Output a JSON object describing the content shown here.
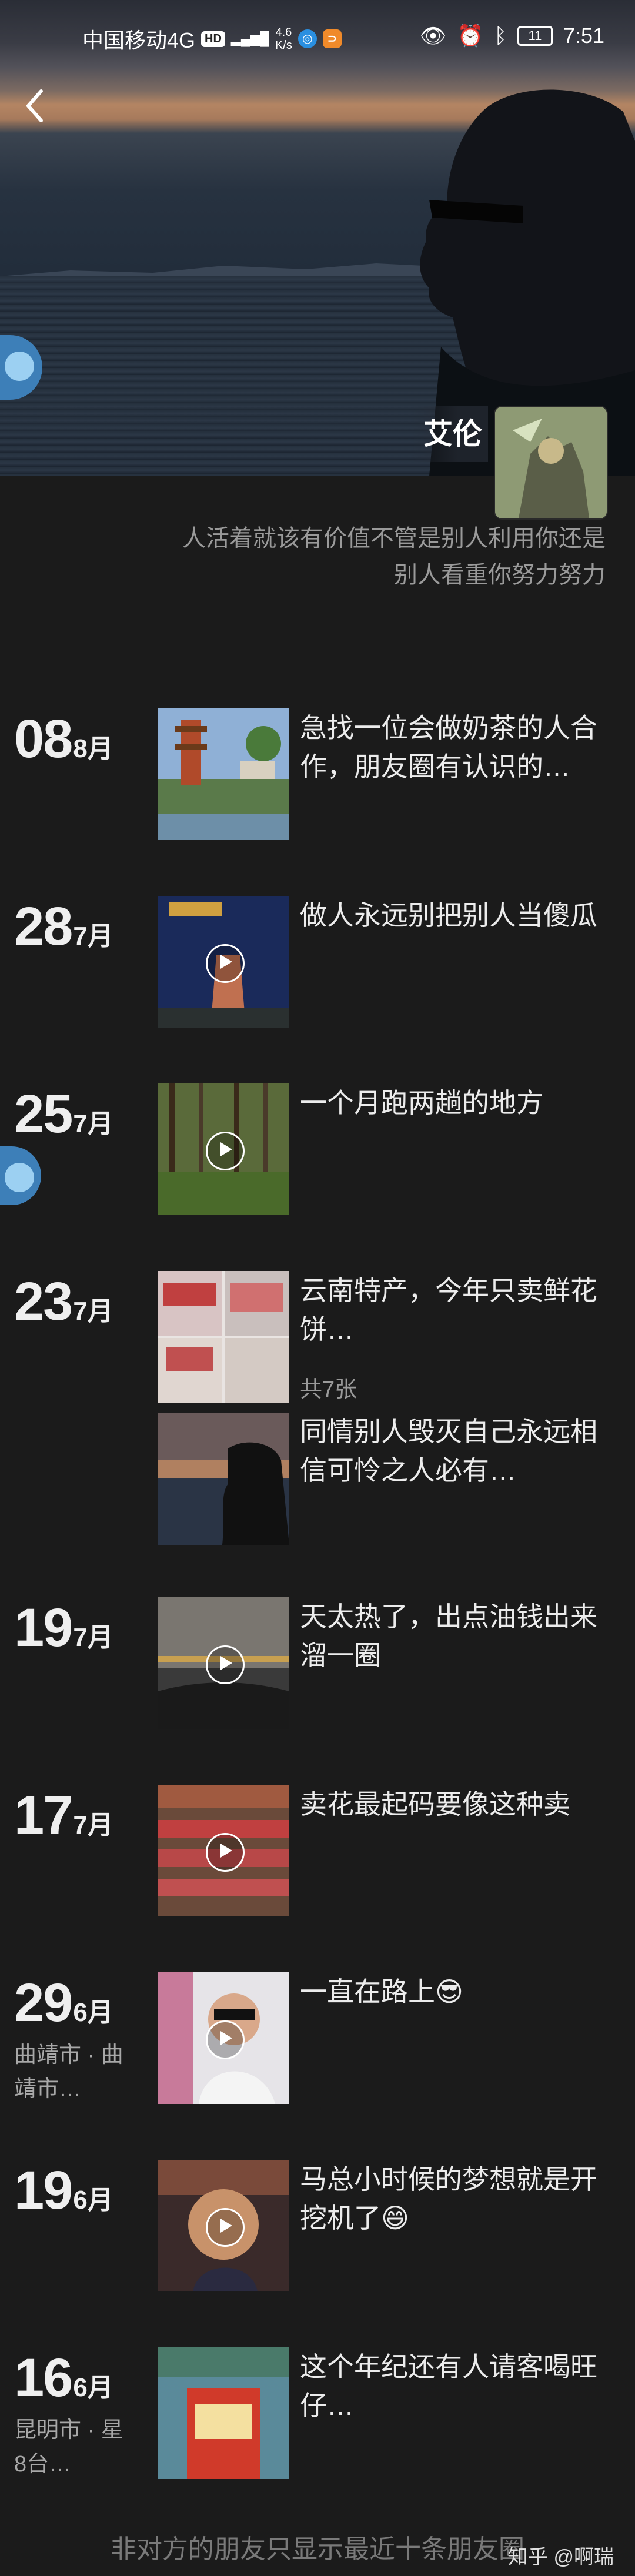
{
  "status_bar": {
    "carrier": "中国移动4G",
    "hd_badge": "HD",
    "network_badge": "4G",
    "speed_value": "4.6",
    "speed_unit": "K/s",
    "battery": "11",
    "time": "7:51",
    "icons": [
      "eye-icon",
      "alarm-icon",
      "bluetooth-icon"
    ]
  },
  "profile": {
    "nickname": "艾伦",
    "signature": "人活着就该有价值不管是别人利用你还是别人看重你努力努力"
  },
  "feed": [
    {
      "day": "08",
      "month": "8月",
      "caption": "急找一位会做奶茶的人合作，朋友圈有认识的…",
      "video": false
    },
    {
      "day": "28",
      "month": "7月",
      "caption": "做人永远别把别人当傻瓜",
      "video": true
    },
    {
      "day": "25",
      "month": "7月",
      "caption": "一个月跑两趟的地方",
      "video": true
    },
    {
      "day": "23",
      "month": "7月",
      "caption": "云南特产，今年只卖鲜花饼…",
      "count": "共7张",
      "caption2": "同情别人毁灭自己永远相信可怜之人必有…",
      "video": false
    },
    {
      "day": "19",
      "month": "7月",
      "caption": "天太热了，出点油钱出来溜一圈",
      "video": true
    },
    {
      "day": "17",
      "month": "7月",
      "caption": "卖花最起码要像这种卖",
      "video": true
    },
    {
      "day": "29",
      "month": "6月",
      "location": "曲靖市 · 曲靖市…",
      "caption": "一直在路上😎",
      "video": true
    },
    {
      "day": "19",
      "month": "6月",
      "caption": "马总小时候的梦想就是开挖机了😄",
      "video": true
    },
    {
      "day": "16",
      "month": "6月",
      "location": "昆明市 · 星8台…",
      "caption": "这个年纪还有人请客喝旺仔…",
      "video": false
    }
  ],
  "footer": {
    "note": "非对方的朋友只显示最近十条朋友圈",
    "watermark": "知乎 @啊瑞"
  }
}
